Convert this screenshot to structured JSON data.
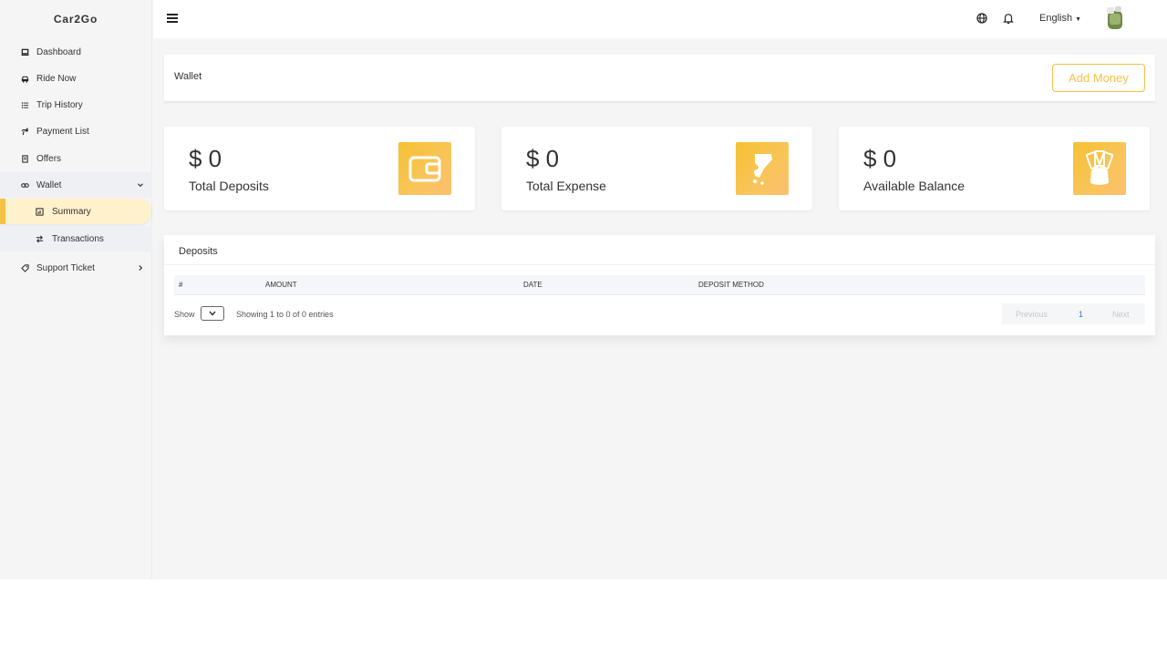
{
  "app": {
    "brand": "Car2Go"
  },
  "sidebar": {
    "items": [
      {
        "label": "Dashboard",
        "icon": "laptop-icon"
      },
      {
        "label": "Ride Now",
        "icon": "car-icon"
      },
      {
        "label": "Trip History",
        "icon": "list-icon"
      },
      {
        "label": "Payment List",
        "icon": "hand-coin-icon"
      },
      {
        "label": "Offers",
        "icon": "receipt-icon"
      },
      {
        "label": "Wallet",
        "icon": "link-icon"
      },
      {
        "label": "Support Ticket",
        "icon": "tag-icon"
      }
    ],
    "wallet_sub": [
      {
        "label": "Summary",
        "icon": "chart-icon"
      },
      {
        "label": "Transactions",
        "icon": "swap-icon"
      }
    ]
  },
  "topbar": {
    "language": "English"
  },
  "page": {
    "title": "Wallet",
    "add_money": "Add Money"
  },
  "cards": [
    {
      "amount": "$ 0",
      "label": "Total Deposits",
      "icon": "wallet-icon"
    },
    {
      "amount": "$ 0",
      "label": "Total Expense",
      "icon": "hand-expense-icon"
    },
    {
      "amount": "$ 0",
      "label": "Available Balance",
      "icon": "money-bag-icon"
    }
  ],
  "deposits": {
    "title": "Deposits",
    "columns": [
      "#",
      "AMOUNT",
      "DATE",
      "DEPOSIT METHOD"
    ],
    "show_label": "Show",
    "info": "Showing 1 to 0 of 0 entries",
    "pagination": {
      "previous": "Previous",
      "current": "1",
      "next": "Next"
    }
  },
  "colors": {
    "accent": "#f5c146",
    "active_bg": "#fff1cc",
    "page_link": "#3b6fe0"
  }
}
